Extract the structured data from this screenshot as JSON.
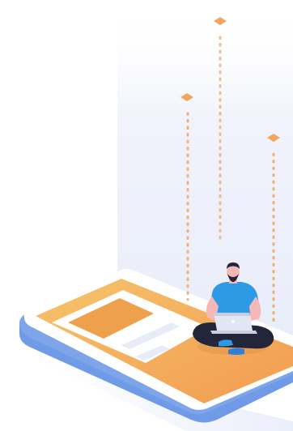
{
  "illustration": {
    "subject": "person-with-laptop-on-phone",
    "icons": [
      "diamond-icon",
      "laptop-icon"
    ]
  },
  "colors": {
    "background": "#ffffff",
    "panel": "#eef1fb",
    "phone_edge": "#7ea5ea",
    "phone_edge_dark": "#5f8ee0",
    "phone_bezel": "#ffffff",
    "screen_orange": "#f2a957",
    "screen_orange_light": "#f6c36a",
    "card_block": "#efa04d",
    "card_line": "#e8ecf7",
    "accent_orange": "#f0a65e",
    "shirt": "#2e9ae6",
    "skin": "#f5b8b6",
    "pants": "#23263a",
    "hair": "#23263a",
    "laptop": "#e2e6f2"
  }
}
